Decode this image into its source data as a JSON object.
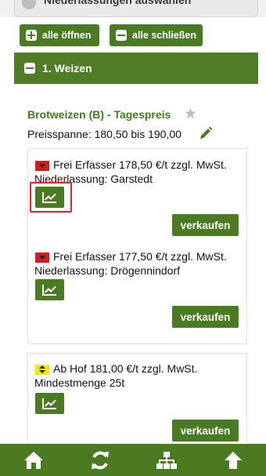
{
  "header": {
    "partial_title": "Niederlassungen auswählen"
  },
  "controls": {
    "open_all": "alle öffnen",
    "close_all": "alle schließen"
  },
  "section": {
    "title": "1. Weizen"
  },
  "product": {
    "title": "Brotweizen (B) - Tagespreis",
    "price_range": "Preisspanne:  180,50 bis 190,00"
  },
  "offers": [
    {
      "trend": "down",
      "line1": "Frei Erfasser 178,50 €/t zzgl. MwSt.",
      "line2": "Niederlassung: Garstedt",
      "sell_label": "verkaufen"
    },
    {
      "trend": "down",
      "line1": "Frei Erfasser 177,50 €/t zzgl. MwSt.",
      "line2": "Niederlassung: Drögennindorf",
      "sell_label": "verkaufen"
    },
    {
      "trend": "neutral",
      "line1": "Ab Hof 181,00 €/t zzgl. MwSt.",
      "line2": "Mindestmenge 25t",
      "sell_label": "verkaufen"
    }
  ],
  "bottom_nav": [
    {
      "icon": "home-icon"
    },
    {
      "icon": "refresh-icon"
    },
    {
      "icon": "sitemap-icon"
    },
    {
      "icon": "arrow-up-icon"
    }
  ],
  "colors": {
    "primary_green": "#4a7a22",
    "title_green": "#3f7a1d",
    "trend_down": "#d71a1a",
    "trend_neutral": "#f5e900",
    "highlight": "#e0262a"
  }
}
